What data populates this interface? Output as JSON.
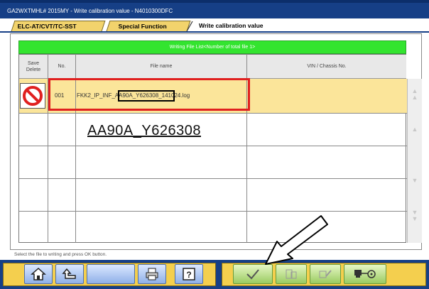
{
  "window": {
    "title": "GA2WXTMHL# 2015MY  -  Write calibration value  -  N4010300DFC"
  },
  "tabs": [
    {
      "label": "ELC-AT/CVT/TC-SST"
    },
    {
      "label": "Special Function"
    },
    {
      "label": "Write calibration value"
    }
  ],
  "list": {
    "header_title": "Writing File List<Number of total file 1>",
    "columns": {
      "save_delete": "Save Delete",
      "no": "No.",
      "file_name": "File name",
      "vin": "VIN / Chassis No."
    },
    "rows": [
      {
        "no": "001",
        "file_prefix": "FKK2_IP_INF_",
        "file_highlight": "AA90A_Y626308",
        "file_suffix": "_141024.log",
        "vin": ""
      }
    ]
  },
  "annotation": {
    "callout_text": "AA90A_Y626308"
  },
  "status": {
    "message": "Select the file to writing and press OK button."
  },
  "colors": {
    "title_bar": "#163f86",
    "selected_row": "#fbe59a",
    "header_bar": "#33e42f",
    "highlight_box": "#e0201f"
  },
  "toolbar_icons": [
    "home-icon",
    "back-icon",
    "print-icon",
    "help-icon",
    "ok-check-icon",
    "delete-file-icon",
    "edit-file-icon",
    "connect-icon"
  ]
}
